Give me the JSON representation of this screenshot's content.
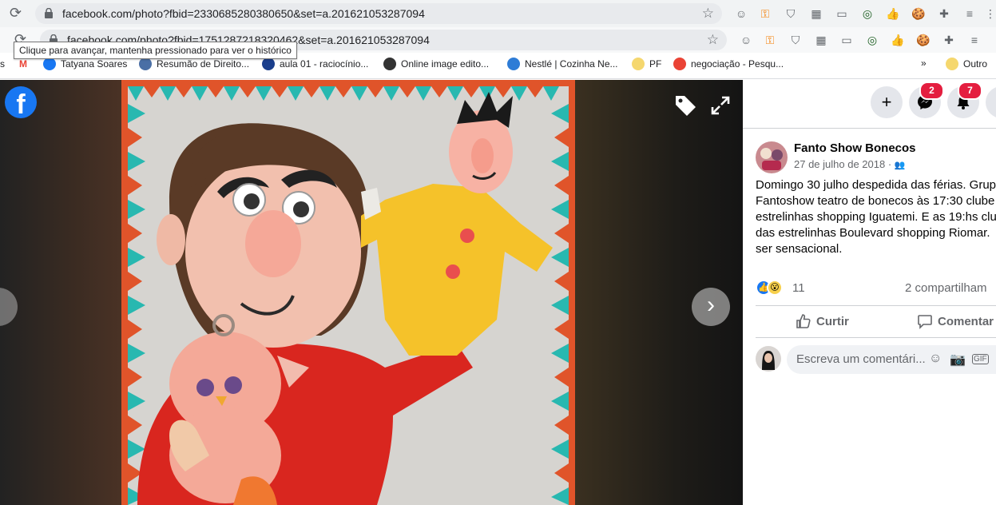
{
  "browser": {
    "tab1_url": "facebook.com/photo?fbid=2330685280380650&set=a.201621053287094",
    "tab2_url": "facebook.com/photo?fbid=1751287218320462&set=a.201621053287094",
    "tooltip": "Clique para avançar, mantenha pressionado para ver o histórico",
    "bookmarks": [
      {
        "label": "Tatyana Soares",
        "color": "#1877f2"
      },
      {
        "label": "Resumão de Direito...",
        "color": "#4a6fa5"
      },
      {
        "label": "aula 01 - raciocínio...",
        "color": "#1a3e8c"
      },
      {
        "label": "Online image edito...",
        "color": "#333333"
      },
      {
        "label": "Nestlé | Cozinha Ne...",
        "color": "#2e7cd6"
      },
      {
        "label": "PF",
        "color": "#f5d76e"
      },
      {
        "label": "negociação - Pesqu...",
        "color": "#ea4335"
      },
      {
        "label": "Outro",
        "color": "#f5d76e"
      }
    ],
    "more_bookmarks": "»"
  },
  "viewer": {
    "logo": "f",
    "next_icon": "›"
  },
  "header": {
    "add_icon": "+",
    "messenger_badge": "2",
    "notifications_badge": "7"
  },
  "post": {
    "author": "Fanto Show Bonecos",
    "date": "27 de julho de 2018 ·",
    "text": "Domingo 30 julho despedida das férias. Grup\nFantoshow teatro de bonecos às 17:30 clube\nestrelinhas shopping Iguatemi. E as 19:hs clu\ndas estrelinhas Boulevard shopping Riomar.\nser sensacional.",
    "reaction_count": "11",
    "shares": "2 compartilham",
    "like_label": "Curtir",
    "comment_label": "Comentar",
    "comment_placeholder": "Escreva um comentári..."
  },
  "colors": {
    "facebook_blue": "#1877f2",
    "badge_red": "#e41e3f",
    "panel_text": "#050505",
    "secondary_text": "#65676b"
  }
}
